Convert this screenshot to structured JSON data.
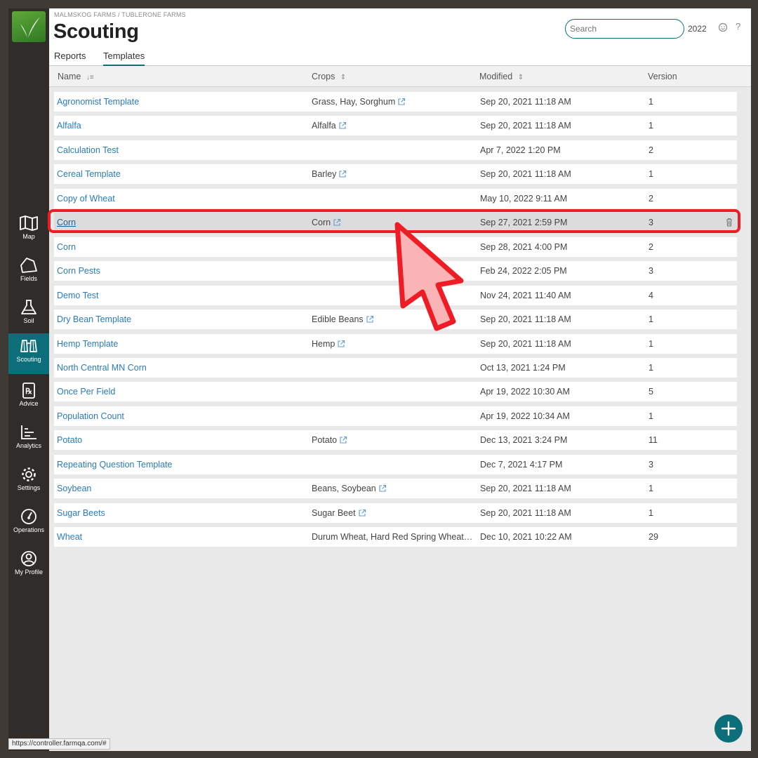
{
  "header": {
    "breadcrumb": "MALMSKOG FARMS / TUBLERONE FARMS",
    "title": "Scouting",
    "search_placeholder": "Search",
    "year": "2022",
    "help": "?"
  },
  "tabs": [
    {
      "label": "Reports",
      "active": false
    },
    {
      "label": "Templates",
      "active": true
    }
  ],
  "columns": {
    "name": "Name",
    "crops": "Crops",
    "modified": "Modified",
    "version": "Version"
  },
  "sidebar": {
    "items": [
      {
        "label": "Map",
        "icon": "map-icon"
      },
      {
        "label": "Fields",
        "icon": "fields-icon"
      },
      {
        "label": "Soil",
        "icon": "flask-icon"
      },
      {
        "label": "Scouting",
        "icon": "binoculars-icon",
        "active": true
      },
      {
        "label": "Advice",
        "icon": "prescription-icon"
      },
      {
        "label": "Analytics",
        "icon": "chart-icon"
      },
      {
        "label": "Settings",
        "icon": "gear-icon"
      },
      {
        "label": "Operations",
        "icon": "gauge-icon"
      },
      {
        "label": "My Profile",
        "icon": "user-icon"
      }
    ]
  },
  "rows": [
    {
      "name": "Agronomist Template",
      "crops": "Grass, Hay, Sorghum",
      "modified": "Sep 20, 2021 11:18 AM",
      "version": "1"
    },
    {
      "name": "Alfalfa",
      "crops": "Alfalfa",
      "modified": "Sep 20, 2021 11:18 AM",
      "version": "1"
    },
    {
      "name": "Calculation Test",
      "crops": "",
      "modified": "Apr 7, 2022 1:20 PM",
      "version": "2"
    },
    {
      "name": "Cereal Template",
      "crops": "Barley",
      "modified": "Sep 20, 2021 11:18 AM",
      "version": "1"
    },
    {
      "name": "Copy of Wheat",
      "crops": "",
      "modified": "May 10, 2022 9:11 AM",
      "version": "2"
    },
    {
      "name": "Corn",
      "crops": "Corn",
      "modified": "Sep 27, 2021 2:59 PM",
      "version": "3",
      "highlighted": true
    },
    {
      "name": "Corn",
      "crops": "",
      "modified": "Sep 28, 2021 4:00 PM",
      "version": "2"
    },
    {
      "name": "Corn Pests",
      "crops": "",
      "modified": "Feb 24, 2022 2:05 PM",
      "version": "3"
    },
    {
      "name": "Demo Test",
      "crops": "",
      "modified": "Nov 24, 2021 11:40 AM",
      "version": "4"
    },
    {
      "name": "Dry Bean Template",
      "crops": "Edible Beans",
      "modified": "Sep 20, 2021 11:18 AM",
      "version": "1"
    },
    {
      "name": "Hemp Template",
      "crops": "Hemp",
      "modified": "Sep 20, 2021 11:18 AM",
      "version": "1"
    },
    {
      "name": "North Central MN Corn",
      "crops": "",
      "modified": "Oct 13, 2021 1:24 PM",
      "version": "1"
    },
    {
      "name": "Once Per Field",
      "crops": "",
      "modified": "Apr 19, 2022 10:30 AM",
      "version": "5"
    },
    {
      "name": "Population Count",
      "crops": "",
      "modified": "Apr 19, 2022 10:34 AM",
      "version": "1"
    },
    {
      "name": "Potato",
      "crops": "Potato",
      "modified": "Dec 13, 2021 3:24 PM",
      "version": "11"
    },
    {
      "name": "Repeating Question Template",
      "crops": "",
      "modified": "Dec 7, 2021 4:17 PM",
      "version": "3"
    },
    {
      "name": "Soybean",
      "crops": "Beans, Soybean",
      "modified": "Sep 20, 2021 11:18 AM",
      "version": "1"
    },
    {
      "name": "Sugar Beets",
      "crops": "Sugar Beet",
      "modified": "Sep 20, 2021 11:18 AM",
      "version": "1"
    },
    {
      "name": "Wheat",
      "crops": "Durum Wheat, Hard Red Spring Wheat, ...",
      "modified": "Dec 10, 2021 10:22 AM",
      "version": "29"
    }
  ],
  "status_bar": "https://controller.farmqa.com/#",
  "colors": {
    "accent": "#0b6e79",
    "link": "#2b7bb9",
    "annotation": "#ee1c25"
  }
}
